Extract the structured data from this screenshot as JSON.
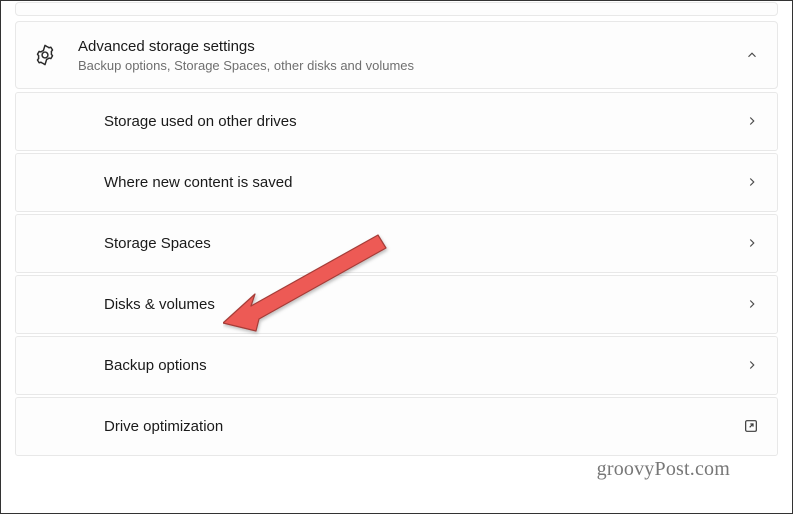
{
  "header": {
    "title": "Advanced storage settings",
    "subtitle": "Backup options, Storage Spaces, other disks and volumes"
  },
  "items": [
    {
      "label": "Storage used on other drives",
      "action": "navigate"
    },
    {
      "label": "Where new content is saved",
      "action": "navigate"
    },
    {
      "label": "Storage Spaces",
      "action": "navigate"
    },
    {
      "label": "Disks & volumes",
      "action": "navigate"
    },
    {
      "label": "Backup options",
      "action": "navigate"
    },
    {
      "label": "Drive optimization",
      "action": "external"
    }
  ],
  "watermark": "groovyPost.com"
}
